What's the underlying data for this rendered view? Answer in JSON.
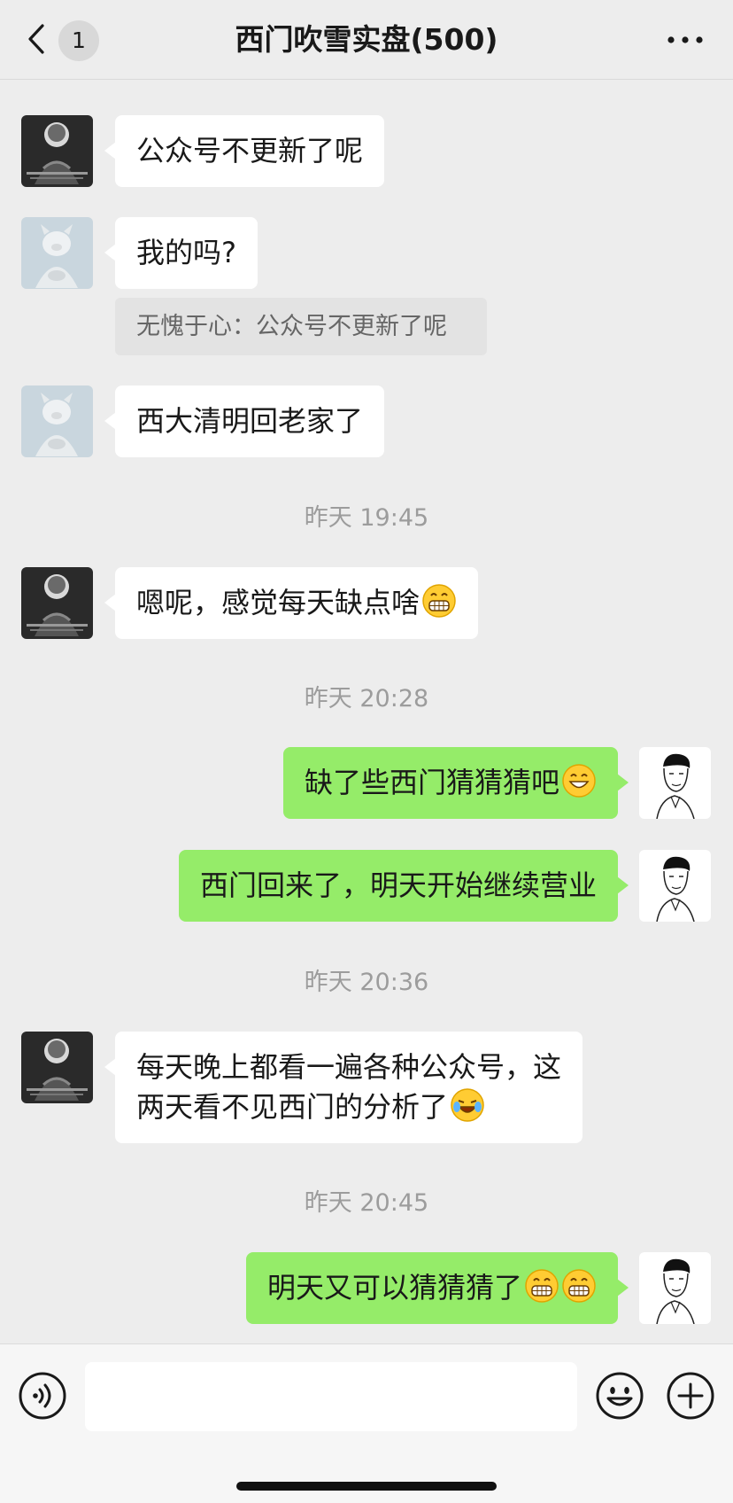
{
  "header": {
    "unread_count": "1",
    "title": "西门吹雪实盘(500)"
  },
  "messages": [
    {
      "text": "公众号不更新了呢"
    },
    {
      "text": "我的吗?",
      "quote": "无愧于心：公众号不更新了呢"
    },
    {
      "text": "西大清明回老家了"
    },
    {
      "time": "昨天 19:45"
    },
    {
      "text": "嗯呢，感觉每天缺点啥"
    },
    {
      "time": "昨天 20:28"
    },
    {
      "text": "缺了些西门猜猜猜吧"
    },
    {
      "text": "西门回来了，明天开始继续营业"
    },
    {
      "time": "昨天 20:36"
    },
    {
      "text_line1": "每天晚上都看一遍各种公众号，这",
      "text_line2": "两天看不见西门的分析了"
    },
    {
      "time": "昨天 20:45"
    },
    {
      "text": "明天又可以猜猜猜了"
    }
  ],
  "colors": {
    "background": "#ededed",
    "incoming_bubble": "#ffffff",
    "outgoing_bubble": "#95ec69"
  },
  "icons": [
    "back-icon",
    "more-icon",
    "voice-icon",
    "emoji-icon",
    "plus-icon",
    "grin-emoji",
    "smile-emoji",
    "laugh-cry-emoji"
  ]
}
